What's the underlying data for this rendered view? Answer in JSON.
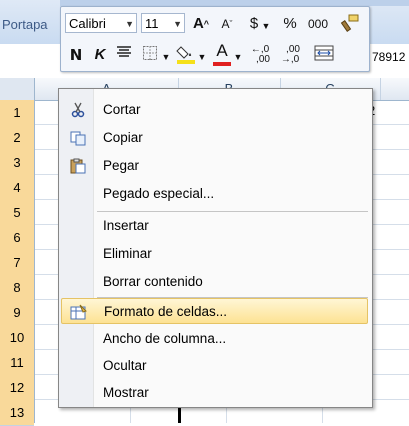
{
  "ribbon": {
    "group_label": "Portapa"
  },
  "sheet": {
    "cell_value": "78912",
    "columns": [
      "A",
      "B",
      "C"
    ],
    "rows": [
      "1",
      "2",
      "3",
      "4",
      "5",
      "6",
      "7",
      "8",
      "9",
      "10",
      "11",
      "12",
      "13"
    ],
    "row_overlap_value": "2"
  },
  "mini_toolbar": {
    "font_name": "Calibri",
    "font_size": "11",
    "grow_font": "A",
    "shrink_font": "A",
    "currency": "$",
    "percent": "%",
    "thousands": "000",
    "bold": "N",
    "italic": "K",
    "font_color_letter": "A",
    "increase_decimals": "←,0 ,00",
    "decrease_decimals": ",00 →,0"
  },
  "context_menu": {
    "items": [
      {
        "label": "Cortar",
        "icon": "scissors-icon"
      },
      {
        "label": "Copiar",
        "icon": "copy-icon"
      },
      {
        "label": "Pegar",
        "icon": "paste-icon"
      },
      {
        "label": "Pegado especial...",
        "icon": ""
      },
      {
        "label": "Insertar",
        "icon": ""
      },
      {
        "label": "Eliminar",
        "icon": ""
      },
      {
        "label": "Borrar contenido",
        "icon": ""
      },
      {
        "label": "Formato de celdas...",
        "icon": "format-cells-icon"
      },
      {
        "label": "Ancho de columna...",
        "icon": ""
      },
      {
        "label": "Ocultar",
        "icon": ""
      },
      {
        "label": "Mostrar",
        "icon": ""
      }
    ],
    "highlighted": "Formato de celdas..."
  },
  "colors": {
    "accent_highlight": "#fde293",
    "header_blue": "#dfe7f1",
    "font_color_bar": "#e02020",
    "fill_color_bar": "#f5e01a"
  }
}
